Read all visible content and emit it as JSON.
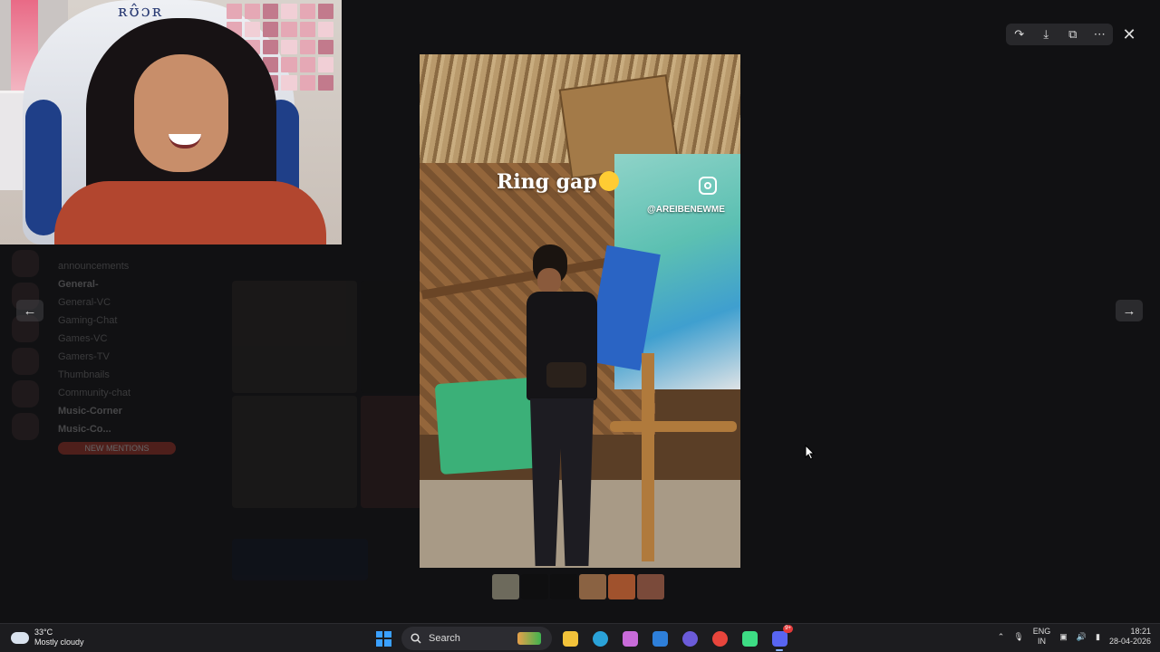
{
  "background_app": {
    "title": "",
    "channels": [
      {
        "label": "announcements",
        "bold": false
      },
      {
        "label": "General-",
        "bold": true
      },
      {
        "label": "General-VC",
        "bold": false
      },
      {
        "label": "Gaming-Chat",
        "bold": false
      },
      {
        "label": "Games-VC",
        "bold": false
      },
      {
        "label": "Gamers-TV",
        "bold": false
      },
      {
        "label": "Thumbnails",
        "bold": false
      },
      {
        "label": "Community-chat",
        "bold": false
      },
      {
        "label": "Music-Corner",
        "bold": true
      },
      {
        "label": "Music-Co...",
        "bold": true
      }
    ],
    "new_mentions_label": "NEW MENTIONS"
  },
  "webcam": {
    "chair_text": "ʀʊ̂ɔʀ"
  },
  "media_viewer": {
    "caption": "Ring gap",
    "caption_emoji": "laughing-emoji",
    "watermark_handle": "@AREIBENEWME",
    "toolbar": {
      "icons": [
        "forward-icon",
        "download-icon",
        "open-external-icon",
        "more-icon"
      ],
      "close_icon": "close-icon"
    },
    "prev_icon": "arrow-left-icon",
    "next_icon": "arrow-right-icon",
    "thumbnail_colors": [
      "#6d6a5c",
      "#0f0f10",
      "#0f0f10",
      "#8a6242",
      "#a0522d",
      "#7a4a3a"
    ]
  },
  "taskbar": {
    "weather": {
      "temp": "33°C",
      "condition": "Mostly cloudy"
    },
    "search_placeholder": "Search",
    "apps": [
      {
        "name": "file-explorer-icon",
        "color": "#f2c23a"
      },
      {
        "name": "edge-icon",
        "color": "#2aa2d8"
      },
      {
        "name": "copilot-icon",
        "color": "#c86bd9"
      },
      {
        "name": "store-icon",
        "color": "#2e7fd9"
      },
      {
        "name": "circle-app-icon",
        "color": "#6b5bd9"
      },
      {
        "name": "chrome-icon",
        "color": "#e8453c"
      },
      {
        "name": "android-app-icon",
        "color": "#3ddc84"
      },
      {
        "name": "discord-icon",
        "color": "#5865f2",
        "badge": "9+"
      }
    ],
    "language": {
      "line1": "ENG",
      "line2": "IN"
    },
    "time": "18:21",
    "date": "28-04-2026"
  }
}
